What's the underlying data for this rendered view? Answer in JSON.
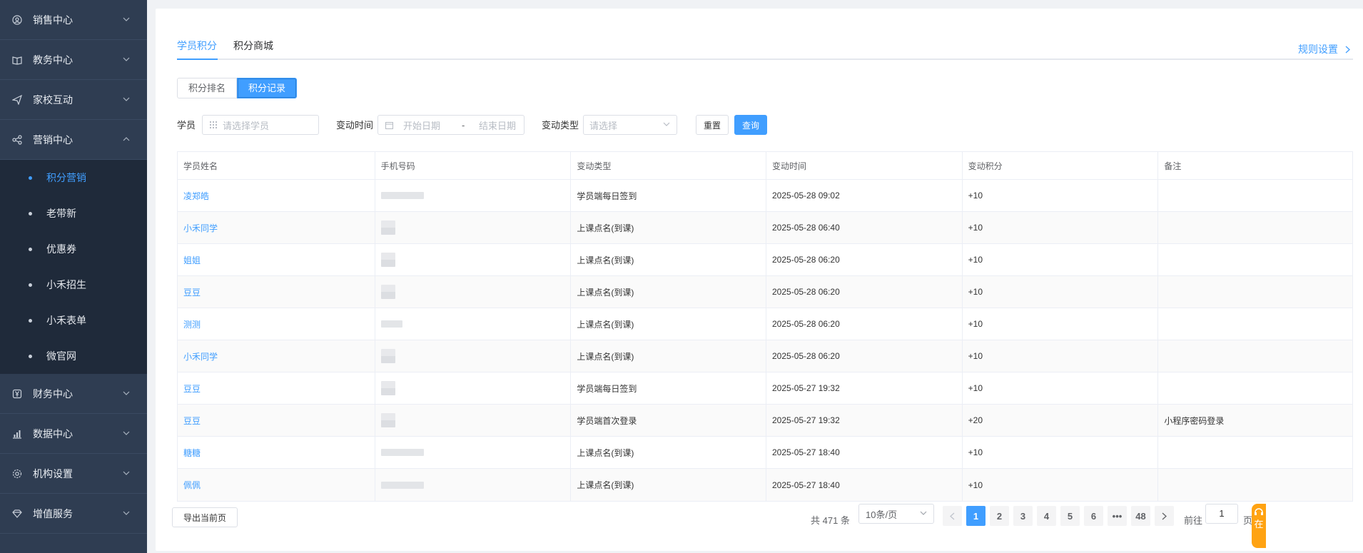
{
  "sidebar": {
    "groups_top": [
      {
        "label": "销售中心",
        "icon": "user-circle-icon"
      },
      {
        "label": "教务中心",
        "icon": "book-icon"
      },
      {
        "label": "家校互动",
        "icon": "paper-plane-icon"
      },
      {
        "label": "营销中心",
        "icon": "share-icon"
      }
    ],
    "sub_items": [
      {
        "label": "积分营销",
        "active": true
      },
      {
        "label": "老带新"
      },
      {
        "label": "优惠券"
      },
      {
        "label": "小禾招生"
      },
      {
        "label": "小禾表单"
      },
      {
        "label": "微官网"
      }
    ],
    "groups_bottom": [
      {
        "label": "财务中心",
        "icon": "yen-icon"
      },
      {
        "label": "数据中心",
        "icon": "bar-chart-icon"
      },
      {
        "label": "机构设置",
        "icon": "gear-icon"
      },
      {
        "label": "增值服务",
        "icon": "gem-icon"
      }
    ]
  },
  "tabs": [
    {
      "label": "学员积分",
      "active": true
    },
    {
      "label": "积分商城"
    }
  ],
  "rule_link": "规则设置",
  "segments": [
    {
      "label": "积分排名"
    },
    {
      "label": "积分记录",
      "active": true
    }
  ],
  "filters": {
    "student_label": "学员",
    "student_placeholder": "请选择学员",
    "time_label": "变动时间",
    "start_placeholder": "开始日期",
    "separator": "-",
    "end_placeholder": "结束日期",
    "type_label": "变动类型",
    "type_placeholder": "请选择",
    "reset": "重置",
    "query": "查询"
  },
  "table": {
    "headers": [
      "学员姓名",
      "手机号码",
      "变动类型",
      "变动时间",
      "变动积分",
      "备注"
    ],
    "rows": [
      {
        "name": "凌郑皓",
        "type": "学员端每日签到",
        "time": "2025-05-28 09:02",
        "points": "+10",
        "note": ""
      },
      {
        "name": "小禾同学",
        "type": "上课点名(到课)",
        "time": "2025-05-28 06:40",
        "points": "+10",
        "note": ""
      },
      {
        "name": "姐姐",
        "type": "上课点名(到课)",
        "time": "2025-05-28 06:20",
        "points": "+10",
        "note": ""
      },
      {
        "name": "豆豆",
        "type": "上课点名(到课)",
        "time": "2025-05-28 06:20",
        "points": "+10",
        "note": ""
      },
      {
        "name": "测测",
        "type": "上课点名(到课)",
        "time": "2025-05-28 06:20",
        "points": "+10",
        "note": ""
      },
      {
        "name": "小禾同学",
        "type": "上课点名(到课)",
        "time": "2025-05-28 06:20",
        "points": "+10",
        "note": ""
      },
      {
        "name": "豆豆",
        "type": "学员端每日签到",
        "time": "2025-05-27 19:32",
        "points": "+10",
        "note": ""
      },
      {
        "name": "豆豆",
        "type": "学员端首次登录",
        "time": "2025-05-27 19:32",
        "points": "+20",
        "note": "小程序密码登录"
      },
      {
        "name": "糖糖",
        "type": "上课点名(到课)",
        "time": "2025-05-27 18:40",
        "points": "+10",
        "note": ""
      },
      {
        "name": "佩佩",
        "type": "上课点名(到课)",
        "time": "2025-05-27 18:40",
        "points": "+10",
        "note": ""
      }
    ]
  },
  "footer": {
    "export": "导出当前页",
    "total": "共 471 条",
    "page_size": "10条/页",
    "pages": [
      "1",
      "2",
      "3",
      "4",
      "5",
      "6",
      "•••",
      "48"
    ],
    "goto_label": "前往",
    "goto_value": "1",
    "page_suffix": "页"
  },
  "float_widget": "在"
}
